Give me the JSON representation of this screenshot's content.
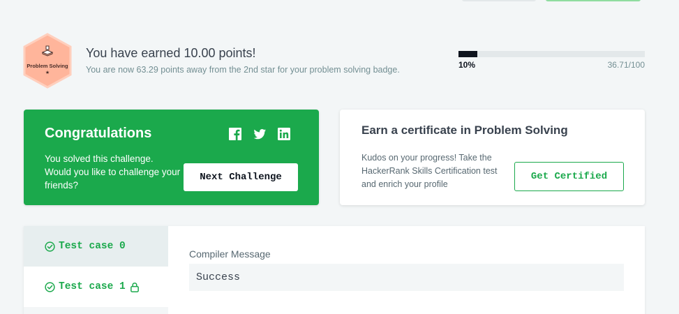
{
  "badge": {
    "label": "Problem Solving",
    "star": "★",
    "icon": "keyboard-icon",
    "colors": {
      "fill": "#ffb59b",
      "stroke": "#ffcfbd"
    }
  },
  "points": {
    "title": "You have earned 10.00 points!",
    "subtitle": "You are now 63.29 points away from the 2nd star for your problem solving badge."
  },
  "progress": {
    "percent_label": "10%",
    "fraction": 0.1,
    "score": "36.71/100"
  },
  "congrats": {
    "title": "Congratulations",
    "text": "You solved this challenge. Would you like to challenge your friends?",
    "share_icons": [
      "facebook-icon",
      "twitter-icon",
      "linkedin-icon"
    ],
    "button": "Next Challenge",
    "color": "#1ba94c"
  },
  "certificate": {
    "title": "Earn a certificate in Problem Solving",
    "text": "Kudos on your progress! Take the HackerRank Skills Certification test and enrich your profile",
    "button": "Get Certified"
  },
  "test_cases": [
    {
      "label": "Test case 0",
      "status_icon": "check-circle-icon",
      "locked": false
    },
    {
      "label": "Test case 1",
      "status_icon": "check-circle-icon",
      "locked": true,
      "lock_icon": "lock-icon"
    }
  ],
  "result": {
    "label": "Compiler Message",
    "message": "Success"
  }
}
